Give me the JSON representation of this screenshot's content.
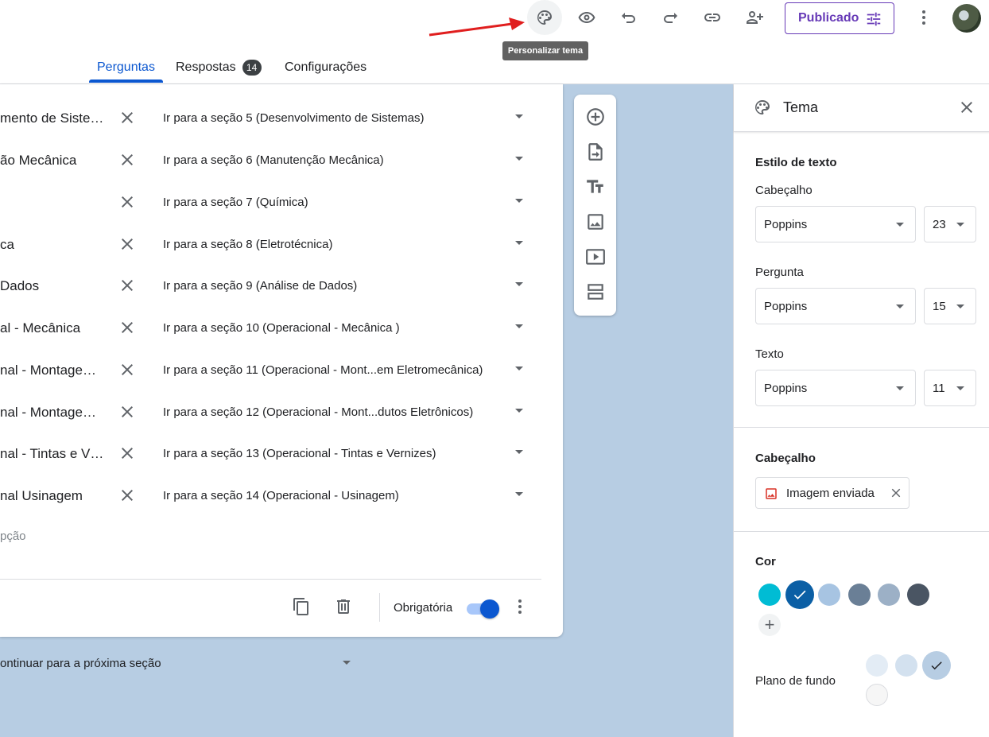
{
  "toolbar": {
    "tooltip": "Personalizar tema",
    "publish_label": "Publicado"
  },
  "tabs": [
    {
      "label": "Perguntas"
    },
    {
      "label": "Respostas",
      "badge": "14"
    },
    {
      "label": "Configurações"
    }
  ],
  "rows": [
    {
      "label": "mento de Siste…",
      "goto": "Ir para a seção 5 (Desenvolvimento de Sistemas)"
    },
    {
      "label": "ão Mecânica",
      "goto": "Ir para a seção 6 (Manutenção Mecânica)"
    },
    {
      "label": "",
      "goto": "Ir para a seção 7 (Química)"
    },
    {
      "label": "ca",
      "goto": "Ir para a seção 8 (Eletrotécnica)"
    },
    {
      "label": "Dados",
      "goto": "Ir para a seção 9 (Análise de Dados)"
    },
    {
      "label": "al - Mecânica",
      "goto": "Ir para a seção 10 (Operacional - Mecânica )"
    },
    {
      "label": "nal - Montage…",
      "goto": "Ir para a seção 11 (Operacional - Mont...em Eletromecânica)"
    },
    {
      "label": "nal - Montage…",
      "goto": "Ir para a seção 12 (Operacional - Mont...dutos Eletrônicos)"
    },
    {
      "label": "nal - Tintas e V…",
      "goto": "Ir para a seção 13 (Operacional - Tintas e Vernizes)"
    },
    {
      "label": "nal Usinagem",
      "goto": "Ir para a seção 14 (Operacional - Usinagem)"
    }
  ],
  "card": {
    "add_option": "pção",
    "required_label": "Obrigatória",
    "section_nav": "ontinuar para a próxima seção"
  },
  "panel": {
    "title": "Tema",
    "text_style_heading": "Estilo de texto",
    "header_label": "Cabeçalho",
    "header_font": "Poppins",
    "header_size": "23",
    "question_label": "Pergunta",
    "question_font": "Poppins",
    "question_size": "15",
    "text_label": "Texto",
    "text_font": "Poppins",
    "text_size": "11",
    "header_section_heading": "Cabeçalho",
    "header_image_chip": "Imagem enviada",
    "color_heading": "Cor",
    "background_label": "Plano de fundo",
    "colors": [
      "#00bcd4",
      "#0b5fa5",
      "#a7c4e2",
      "#6a7f96",
      "#9cb0c6",
      "#4a5563"
    ],
    "backgrounds": [
      "#e3ecf5",
      "#d3e1ef",
      "#b7cde3",
      "#f6f6f6"
    ]
  }
}
